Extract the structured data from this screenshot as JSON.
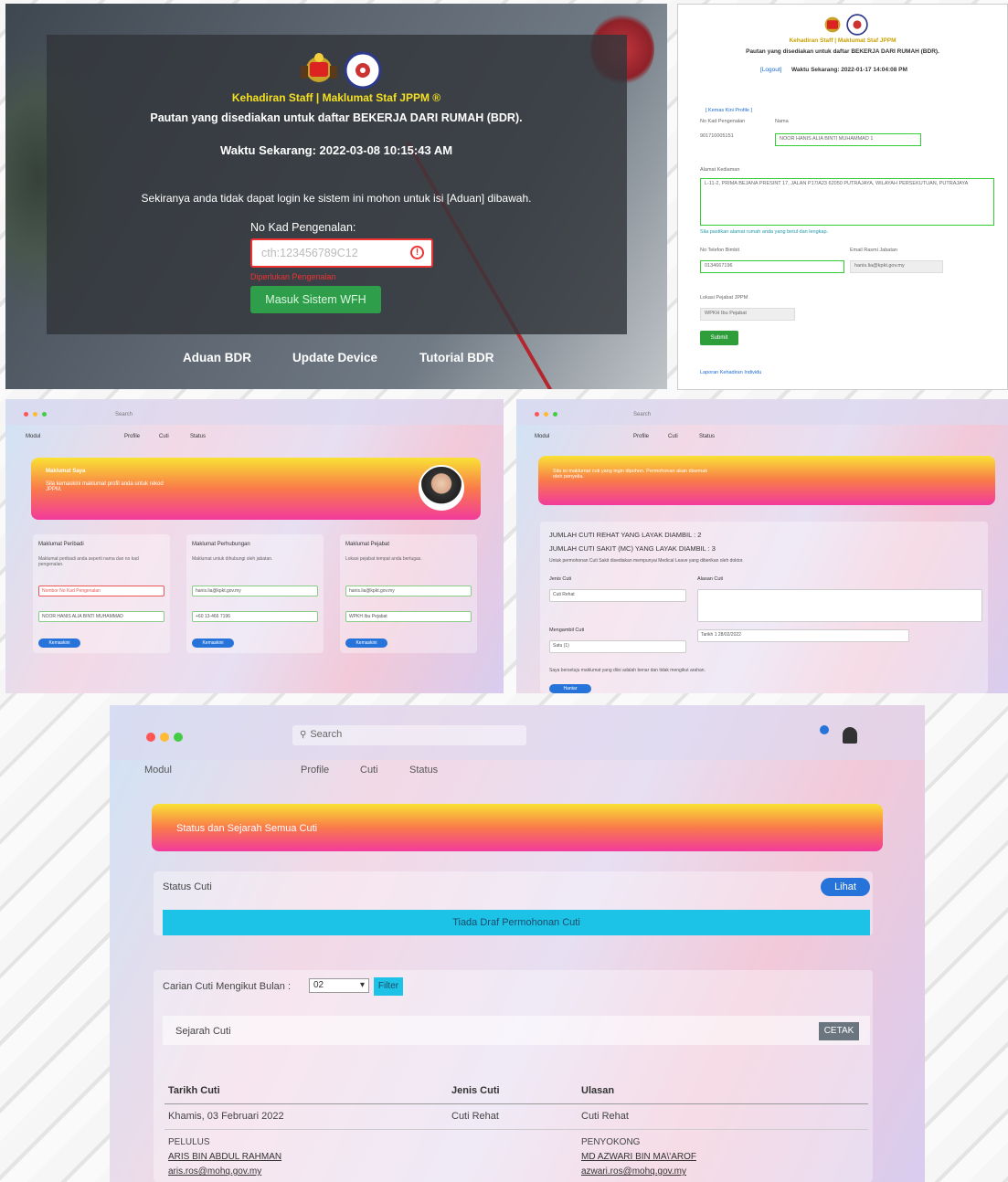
{
  "login": {
    "title": "Kehadiran Staff | Maklumat Staf JPPM ®",
    "subtitle": "Pautan yang disediakan untuk daftar BEKERJA DARI RUMAH (BDR).",
    "time": "Waktu Sekarang: 2022-03-08 10:15:43 AM",
    "notice": "Sekiranya anda tidak dapat login ke sistem ini mohon untuk isi [Aduan] dibawah.",
    "ic_label": "No Kad Pengenalan:",
    "ic_placeholder": "cth:123456789C12",
    "required": "Diperlukan Pengenalan",
    "submit": "Masuk Sistem WFH",
    "nav": [
      "Aduan BDR",
      "Update Device",
      "Tutorial BDR"
    ]
  },
  "register": {
    "title": "Kehadiran Staff | Maklumat Staf JPPM",
    "subtitle": "Pautan yang disediakan untuk daftar BEKERJA DARI RUMAH (BDR).",
    "time_prefix": "[Logout]",
    "time": "Waktu Sekarang: 2022-01-17 14:04:08 PM",
    "link": "[ Kemas Kini Profile ]",
    "ic_label": "No Kad Pengenalan",
    "ic_value": "901710005151",
    "name_label": "Nama",
    "name_value": "NOOR HANIS ALIA BINTI MUHAMMAD 1",
    "address_label": "Alamat Kediaman",
    "address_value": "L-11-2, PRIMA BEJANA PRESINT 17, JALAN P17/A23 62050 PUTRAJAYA, WILAYAH PERSEKUTUAN, PUTRAJAYA",
    "address_hint": "Sila pastikan alamat rumah anda yang betul dan lengkap.",
    "phone_label": "No Telefon Bimbit",
    "phone_value": "0134667196",
    "email_label": "Email Rasmi Jabatan",
    "email_value": "hanis.lia@kpkt.gov.my",
    "office_label": "Lokasi Pejabat JPPM",
    "office_value": "WPKH Ibu Pejabat",
    "submit": "Submit",
    "footer": "Laporan Kehadiran Individu"
  },
  "app": {
    "search": "Search",
    "module": "Modul",
    "tabs": [
      "Profile",
      "Cuti",
      "Status"
    ]
  },
  "profile": {
    "hero_title": "Maklumat Saya",
    "hero_text": "Sila kemaskini maklumat profil anda untuk rekod JPPM.",
    "cards": [
      {
        "title": "Maklumat Peribadi",
        "desc": "Maklumat peribadi anda seperti nama dan no kad pengenalan.",
        "f1": "Nombor No Kad Pengenalan",
        "f2": "NOOR HANIS ALIA BINTI MUHAMMAD",
        "btn": "Kemaskini"
      },
      {
        "title": "Maklumat Perhubungan",
        "desc": "Maklumat untuk dihubungi oleh jabatan.",
        "f1": "hanis.lia@kpkt.gov.my",
        "f2": "+60 13-466 7196",
        "btn": "Kemaskini"
      },
      {
        "title": "Maklumat Pejabat",
        "desc": "Lokasi pejabat tempat anda bertugas.",
        "f1": "hanis.lia@kpkt.gov.my",
        "f2": "WPKH Ibu Pejabat",
        "btn": "Kemaskini"
      }
    ]
  },
  "leave": {
    "hero_text": "Sila isi maklumat cuti yang ingin dipohon. Permohonan akan disemak oleh penyelia.",
    "rest": "JUMLAH CUTI REHAT YANG LAYAK DIAMBIL : 2",
    "sick": "JUMLAH CUTI SAKIT (MC) YANG LAYAK DIAMBIL : 3",
    "note": "Untuk permohonan Cuti Sakit disediakan mempunyai Medical Leave yang diberikan oleh doktor.",
    "type_label": "Jenis Cuti",
    "type_value": "Cuti Rehat",
    "reason_label": "Alasan Cuti",
    "dur_label": "Mengambil Cuti",
    "dur_value": "Satu (1)",
    "date_value": "Tarikh 1  28/02/2022",
    "agree": "Saya bersetuju maklumat yang diisi adalah benar dan tidak mengikut arahan.",
    "btn": "Hantar"
  },
  "status": {
    "hero": "Status dan Sejarah Semua Cuti",
    "status_label": "Status Cuti",
    "view_btn": "Lihat",
    "empty": "Tiada Draf Permohonan Cuti",
    "filter_label": "Carian Cuti Mengikut Bulan :",
    "month": "02",
    "filter_btn": "Filter",
    "history": "Sejarah Cuti",
    "print": "CETAK",
    "headers": [
      "Tarikh Cuti",
      "Jenis Cuti",
      "Ulasan"
    ],
    "row": [
      "Khamis, 03 Februari 2022",
      "Cuti Rehat",
      "Cuti Rehat"
    ],
    "left_role": "PELULUS",
    "left_name": "ARIS BIN ABDUL RAHMAN",
    "left_email": "aris.ros@mohq.gov.my",
    "right_role": "PENYOKONG",
    "right_name": "MD AZWARI BIN MA\\'AROF",
    "right_email": "azwari.ros@mohq.gov.my"
  }
}
